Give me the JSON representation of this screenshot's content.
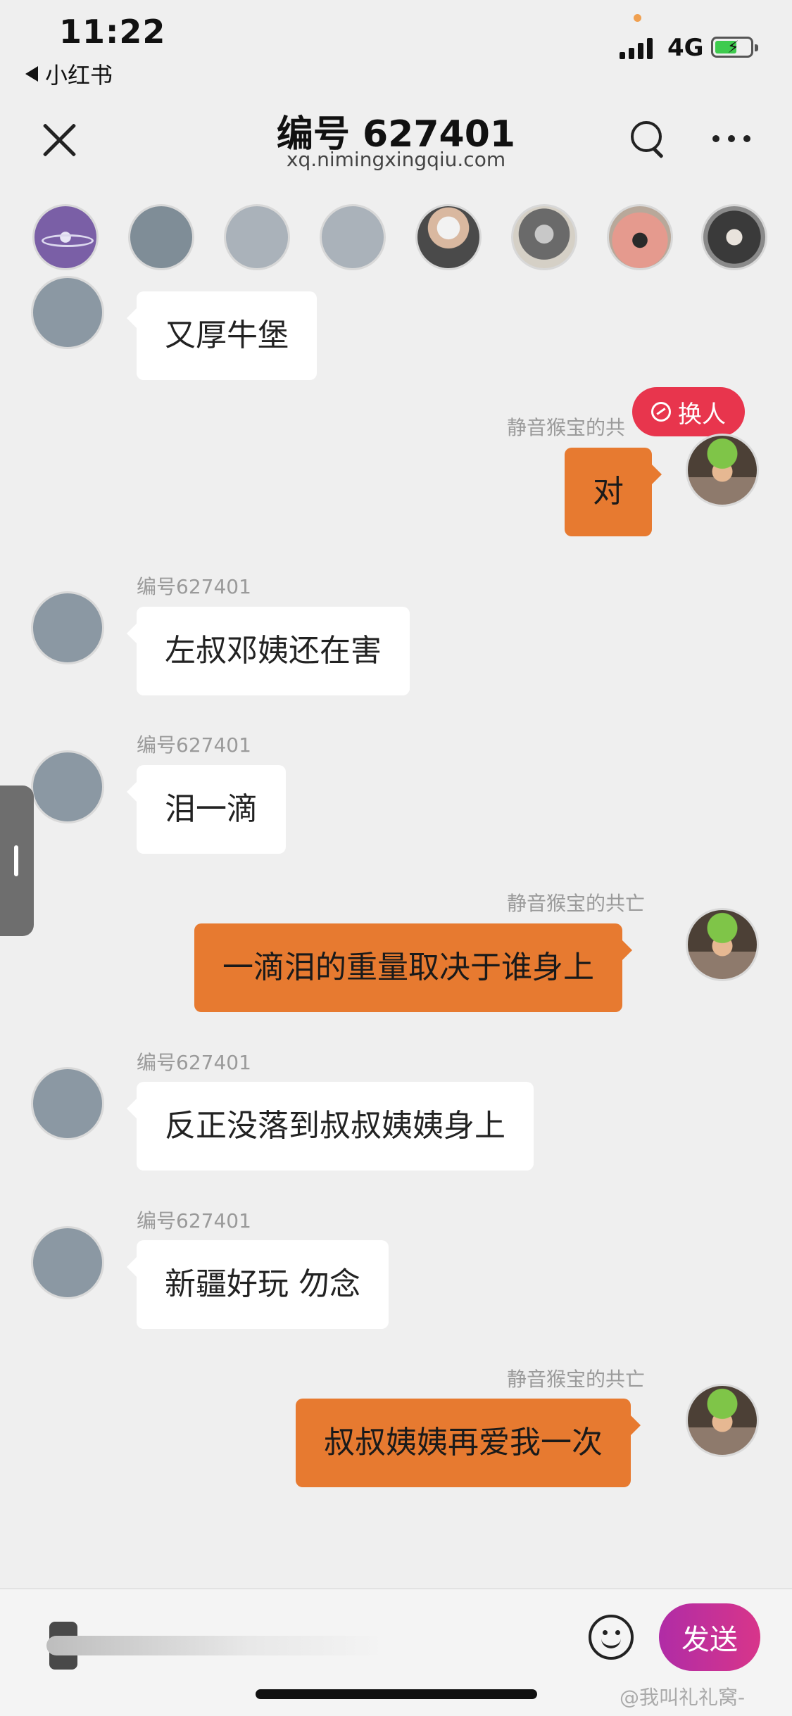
{
  "status": {
    "time": "11:22",
    "back_app": "小红书",
    "network": "4G"
  },
  "header": {
    "title": "编号 627401",
    "subtitle": "xq.nimingxingqiu.com"
  },
  "swap_label": "换人",
  "messages": [
    {
      "side": "left",
      "sender": "",
      "text": "又厚牛堡"
    },
    {
      "side": "right",
      "sender": "静音猴宝的共",
      "text": "对"
    },
    {
      "side": "left",
      "sender": "编号627401",
      "text": "左叔邓姨还在害"
    },
    {
      "side": "left",
      "sender": "编号627401",
      "text": "泪一滴"
    },
    {
      "side": "right",
      "sender": "静音猴宝的共亡",
      "text": "一滴泪的重量取决于谁身上"
    },
    {
      "side": "left",
      "sender": "编号627401",
      "text": "反正没落到叔叔姨姨身上"
    },
    {
      "side": "left",
      "sender": "编号627401",
      "text": "新疆好玩 勿念"
    },
    {
      "side": "right",
      "sender": "静音猴宝的共亡",
      "text": "叔叔姨姨再爱我一次"
    }
  ],
  "composer": {
    "send_label": "发送"
  },
  "watermark": "@我叫礼礼窝-",
  "colors": {
    "my_bubble": "#e77a30",
    "swap_button": "#e8354d",
    "send_gradient": [
      "#b02ca6",
      "#d8358a"
    ]
  }
}
